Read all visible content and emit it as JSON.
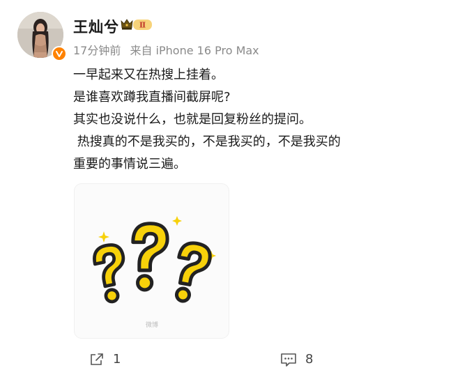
{
  "post": {
    "author_name": "王灿兮",
    "member_badge_text": "Ⅱ",
    "time": "17分钟前",
    "source": "来自 iPhone 16 Pro Max",
    "lines": [
      "一早起来又在热搜上挂着。",
      "是谁喜欢蹲我直播间截屏呢?",
      "其实也没说什么，也就是回复粉丝的提问。",
      " 热搜真的不是我买的，不是我买的，不是我买的",
      "重要的事情说三遍。"
    ],
    "image_watermark": "微博",
    "share_count": "1",
    "comment_count": "8"
  },
  "colors": {
    "verified_badge": "#ff8200",
    "question_mark_fill": "#f7d10a",
    "question_mark_outline": "#222222"
  },
  "icons": {
    "share": "share-icon",
    "comment": "comment-icon",
    "verified": "verified-v-icon",
    "member": "crown-icon"
  }
}
